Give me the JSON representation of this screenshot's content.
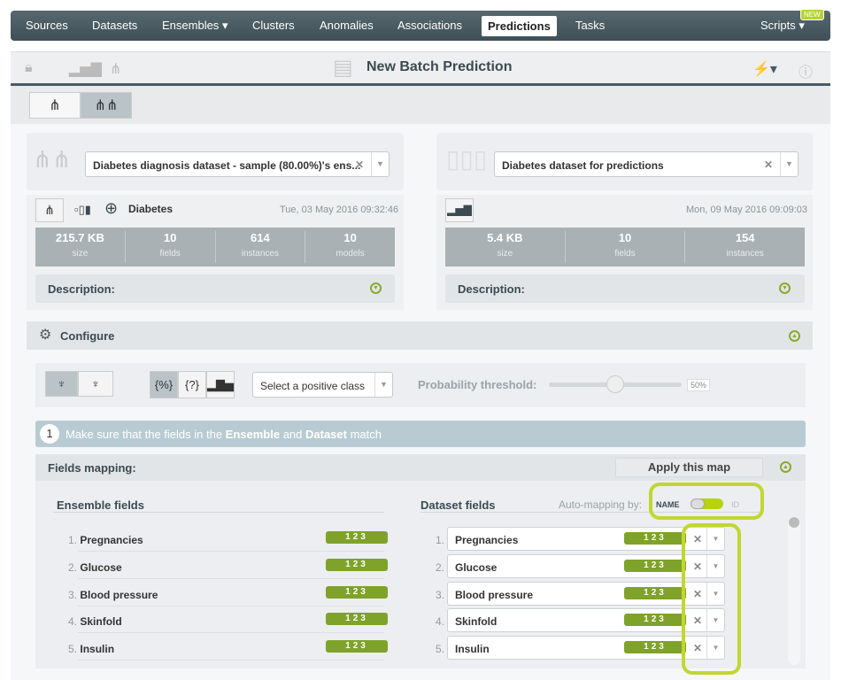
{
  "nav": {
    "items": [
      "Sources",
      "Datasets",
      "Ensembles",
      "Clusters",
      "Anomalies",
      "Associations",
      "Predictions",
      "Tasks"
    ],
    "active": "Predictions",
    "scripts": "Scripts",
    "new_badge": "NEW"
  },
  "toolbar": {
    "title": "New Batch Prediction"
  },
  "ensemble": {
    "selected": "Diabetes diagnosis dataset - sample (80.00%)'s ens...",
    "objective": "Diabetes",
    "date": "Tue, 03 May 2016 09:32:46",
    "stats": [
      {
        "value": "215.7 KB",
        "label": "size"
      },
      {
        "value": "10",
        "label": "fields"
      },
      {
        "value": "614",
        "label": "instances"
      },
      {
        "value": "10",
        "label": "models"
      }
    ],
    "description_label": "Description:"
  },
  "dataset": {
    "selected": "Diabetes dataset for predictions",
    "date": "Mon, 09 May 2016 09:09:03",
    "stats": [
      {
        "value": "5.4 KB",
        "label": "size"
      },
      {
        "value": "10",
        "label": "fields"
      },
      {
        "value": "154",
        "label": "instances"
      }
    ],
    "description_label": "Description:"
  },
  "configure": {
    "label": "Configure",
    "positive_class_placeholder": "Select a positive class",
    "threshold_label": "Probability threshold:",
    "threshold_value": "50%",
    "threshold_percent": 50
  },
  "step": {
    "number": "1",
    "text_pre": "Make sure that the fields in the ",
    "ensemble": "Ensemble",
    "and": " and ",
    "dataset": "Dataset",
    "text_post": " match"
  },
  "mapping": {
    "label": "Fields mapping:",
    "apply": "Apply this map",
    "ensemble_header": "Ensemble fields",
    "dataset_header": "Dataset fields",
    "auto_label": "Auto-mapping by:",
    "name": "NAME",
    "id": "ID",
    "type_badge": "123",
    "ensemble_fields": [
      {
        "n": "1.",
        "name": "Pregnancies"
      },
      {
        "n": "2.",
        "name": "Glucose"
      },
      {
        "n": "3.",
        "name": "Blood pressure"
      },
      {
        "n": "4.",
        "name": "Skinfold"
      },
      {
        "n": "5.",
        "name": "Insulin"
      }
    ],
    "dataset_fields": [
      {
        "n": "1.",
        "name": "Pregnancies"
      },
      {
        "n": "2.",
        "name": "Glucose"
      },
      {
        "n": "3.",
        "name": "Blood pressure"
      },
      {
        "n": "4.",
        "name": "Skinfold"
      },
      {
        "n": "5.",
        "name": "Insulin"
      }
    ]
  },
  "colors": {
    "accent": "#c1d72e",
    "nav": "#4a5a63",
    "badge": "#7fa22a"
  }
}
